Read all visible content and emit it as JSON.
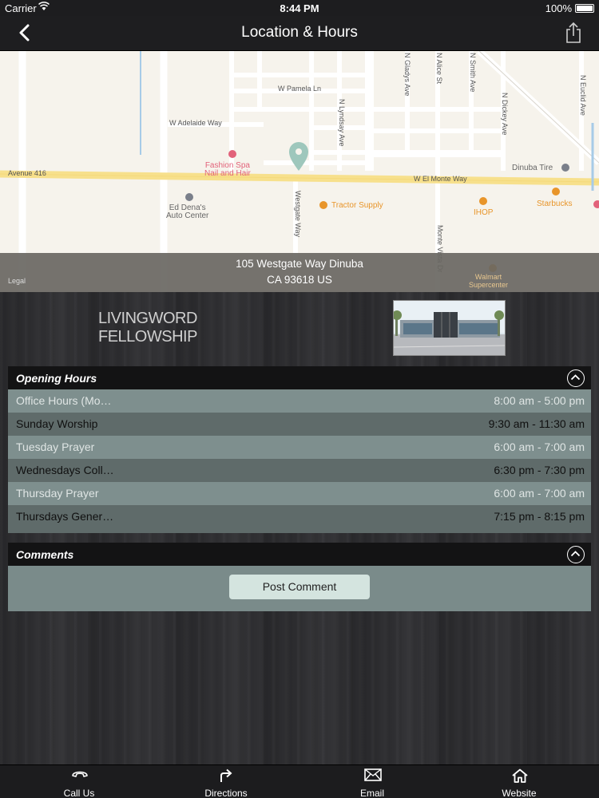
{
  "status_bar": {
    "carrier": "Carrier",
    "time": "8:44 PM",
    "battery": "100%"
  },
  "nav": {
    "title": "Location & Hours",
    "back_icon": "chevron-left-icon",
    "share_icon": "share-icon"
  },
  "map": {
    "labels": {
      "w_pamela": "W Pamela Ln",
      "w_adelaide": "W Adelaide Way",
      "avenue_416": "Avenue 416",
      "w_el_monte": "W El Monte Way",
      "n_lyndsay": "N Lyndsay Ave",
      "westgate": "Westgate Way",
      "n_gladys": "N Gladys Ave",
      "n_alice": "N Alice St",
      "n_smith": "N Smith Ave",
      "n_dickey": "N Dickey Ave",
      "n_euclid": "N Euclid Ave",
      "monte_vista": "Monte Vista Dr",
      "fashion_spa": "Fashion Spa\nNail and Hair",
      "ed_denas": "Ed Dena's\nAuto Center",
      "tractor_supply": "Tractor Supply",
      "ihop": "IHOP",
      "starbucks": "Starbucks",
      "dinuba_tire": "Dinuba Tire",
      "walmart": "Walmart\nSupercenter",
      "legal": "Legal"
    },
    "address_line1": "105 Westgate Way Dinuba",
    "address_line2": "CA 93618 US"
  },
  "logo": {
    "line1": "LIVINGWORD",
    "line2": "FELLOWSHIP"
  },
  "opening_hours": {
    "title": "Opening Hours",
    "toggle_icon": "chevron-up-icon",
    "rows": [
      {
        "name": "Office Hours (Mo…",
        "time": "8:00 am - 5:00 pm"
      },
      {
        "name": "Sunday Worship",
        "time": "9:30 am - 11:30 am"
      },
      {
        "name": "Tuesday Prayer",
        "time": "6:00 am - 7:00 am"
      },
      {
        "name": "Wednesdays Coll…",
        "time": "6:30 pm - 7:30 pm"
      },
      {
        "name": "Thursday Prayer",
        "time": "6:00 am - 7:00 am"
      },
      {
        "name": "Thursdays Gener…",
        "time": "7:15 pm - 8:15 pm"
      }
    ]
  },
  "comments": {
    "title": "Comments",
    "toggle_icon": "chevron-up-icon",
    "post_label": "Post Comment"
  },
  "tabs": [
    {
      "label": "Call Us",
      "icon": "phone-icon"
    },
    {
      "label": "Directions",
      "icon": "directions-arrow-icon"
    },
    {
      "label": "Email",
      "icon": "envelope-icon"
    },
    {
      "label": "Website",
      "icon": "home-icon"
    }
  ]
}
